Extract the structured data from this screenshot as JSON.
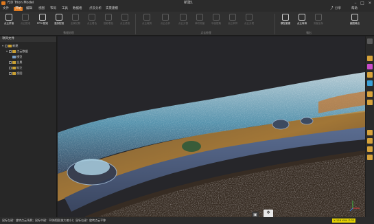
{
  "titlebar": {
    "app_title": "FJD Trion Model",
    "center_title": "新建1"
  },
  "menu": {
    "items": [
      "文件",
      "开始",
      "编辑",
      "视图",
      "布局",
      "工具",
      "数据格",
      "点云分析",
      "实景建模"
    ],
    "active_index": 1,
    "right_share": "分享",
    "right_help": "帮助"
  },
  "ribbon": {
    "buttons": [
      {
        "label": "点云拼接",
        "state": "on"
      },
      {
        "label": "点云配准",
        "state": "off"
      },
      {
        "label": "FPFH配准",
        "state": "on"
      },
      {
        "label": "漫游配准",
        "state": "on"
      },
      {
        "label": "全景拍照",
        "state": "off"
      },
      {
        "label": "点云着色",
        "state": "off"
      },
      {
        "label": "投影着色",
        "state": "off"
      },
      {
        "label": "点云滤波",
        "state": "off"
      },
      {
        "label": "点云裁剪",
        "state": "off"
      },
      {
        "label": "点云合并",
        "state": "off"
      },
      {
        "label": "点云分割",
        "state": "off"
      },
      {
        "label": "体积测量",
        "state": "off"
      },
      {
        "label": "平面提取",
        "state": "off"
      },
      {
        "label": "点云采样",
        "state": "off"
      },
      {
        "label": "点云分类",
        "state": "off"
      },
      {
        "label": "模型重建",
        "state": "on"
      },
      {
        "label": "点云转换",
        "state": "on"
      },
      {
        "label": "测量坐标",
        "state": "off"
      },
      {
        "label": "截图输出",
        "state": "on"
      }
    ],
    "groups": [
      "数据处理",
      "点云处理",
      "输出"
    ]
  },
  "panel": {
    "title": "项目文件",
    "items": [
      {
        "label": "新建",
        "level": 0,
        "expanded": true
      },
      {
        "label": "点云数据",
        "level": 1,
        "expanded": true
      },
      {
        "label": "模型",
        "level": 2,
        "expanded": false
      },
      {
        "label": "全景",
        "level": 1,
        "expanded": false
      },
      {
        "label": "标注",
        "level": 1,
        "expanded": false
      },
      {
        "label": "视图",
        "level": 1,
        "expanded": false
      }
    ]
  },
  "statusbar": {
    "message": "鼠标左键：旋转点云场景；鼠标中键：平移视图(放大缩小)；鼠标右键：旋转点云平移",
    "coord": "X:128 Y:64 Z:32"
  },
  "colors": {
    "accent": "#e07a1f",
    "status_coord_bg": "#e6d400"
  }
}
